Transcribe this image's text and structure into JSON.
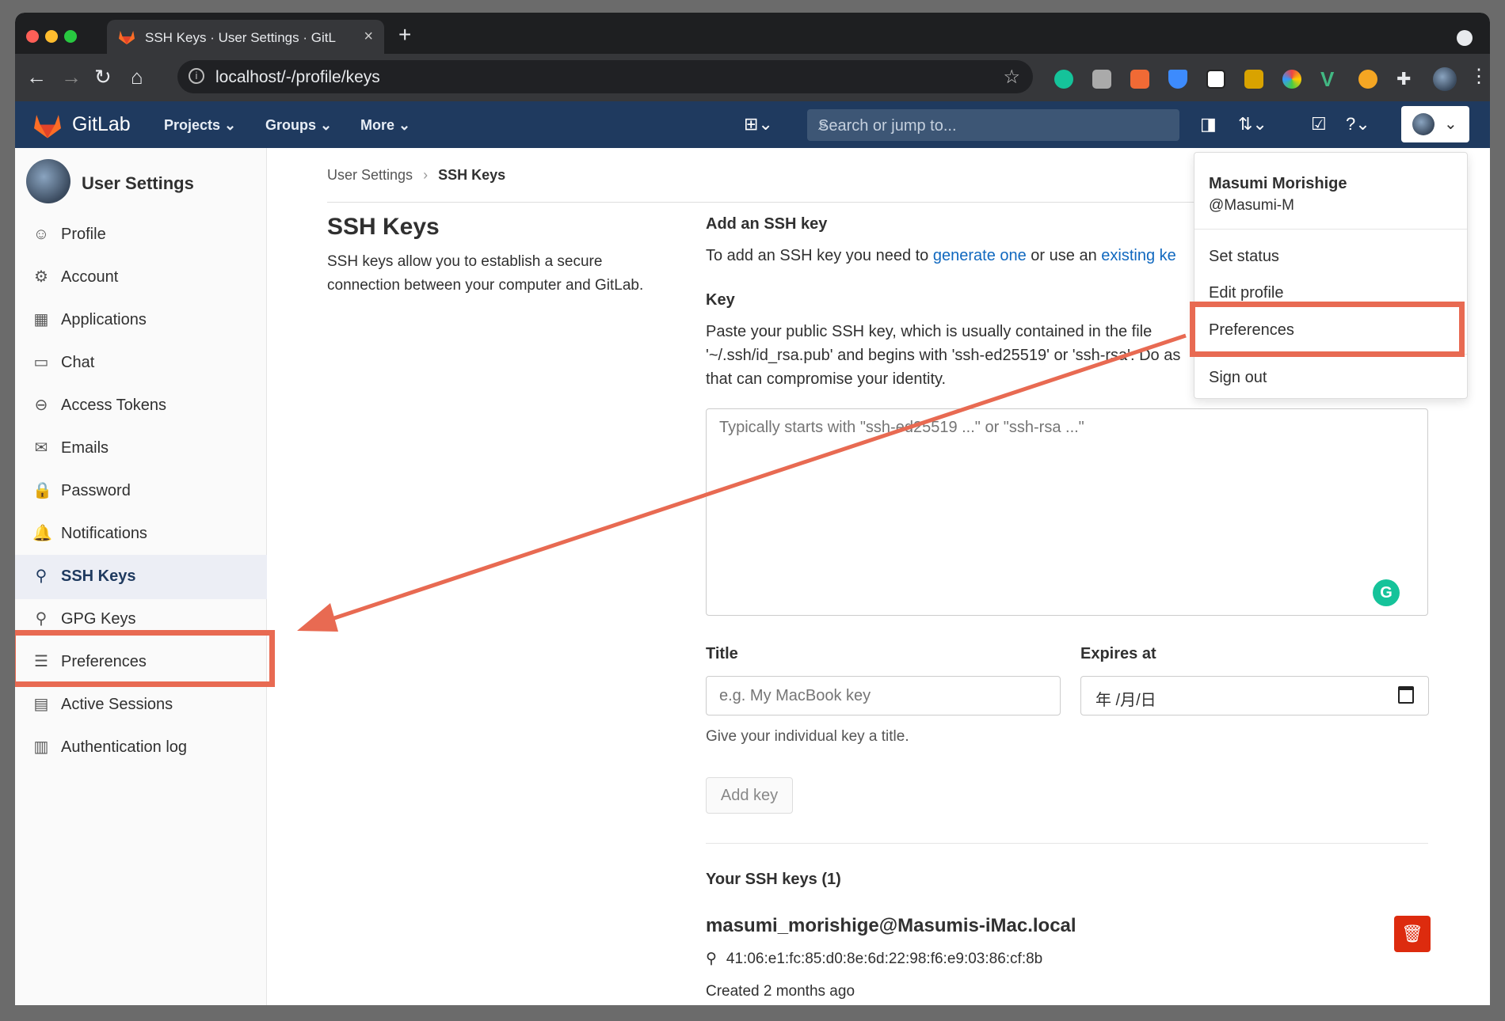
{
  "browser": {
    "tab_title": "SSH Keys · User Settings · GitL",
    "url": "localhost/-/profile/keys",
    "new_tab": "+",
    "close_tab": "×"
  },
  "gitlab_nav": {
    "brand": "GitLab",
    "menus": [
      "Projects",
      "Groups",
      "More"
    ],
    "search_placeholder": "Search or jump to..."
  },
  "sidebar": {
    "title": "User Settings",
    "items": [
      {
        "label": "Profile",
        "icon": "profile-icon"
      },
      {
        "label": "Account",
        "icon": "account-icon"
      },
      {
        "label": "Applications",
        "icon": "applications-icon"
      },
      {
        "label": "Chat",
        "icon": "chat-icon"
      },
      {
        "label": "Access Tokens",
        "icon": "token-icon"
      },
      {
        "label": "Emails",
        "icon": "email-icon"
      },
      {
        "label": "Password",
        "icon": "lock-icon"
      },
      {
        "label": "Notifications",
        "icon": "bell-icon"
      },
      {
        "label": "SSH Keys",
        "icon": "key-icon",
        "active": true
      },
      {
        "label": "GPG Keys",
        "icon": "key-icon"
      },
      {
        "label": "Preferences",
        "icon": "preferences-icon"
      },
      {
        "label": "Active Sessions",
        "icon": "monitor-icon"
      },
      {
        "label": "Authentication log",
        "icon": "log-icon"
      }
    ]
  },
  "breadcrumb": {
    "parent": "User Settings",
    "separator": "›",
    "current": "SSH Keys"
  },
  "main": {
    "heading": "SSH Keys",
    "description": "SSH keys allow you to establish a secure connection between your computer and GitLab.",
    "add_heading": "Add an SSH key",
    "intro_prefix": "To add an SSH key you need to ",
    "intro_link1": "generate one",
    "intro_mid": " or use an ",
    "intro_link2": "existing ke",
    "key_label": "Key",
    "key_help": "Paste your public SSH key, which is usually contained in the file '~/.ssh/id_rsa.pub' and begins with 'ssh-ed25519' or 'ssh-rsa'. Do as that can compromise your identity.",
    "key_placeholder": "Typically starts with \"ssh-ed25519 ...\" or \"ssh-rsa ...\"",
    "title_label": "Title",
    "title_placeholder": "e.g. My MacBook key",
    "expires_label": "Expires at",
    "expires_value": "年 /月/日",
    "title_hint": "Give your individual key a title.",
    "add_button": "Add key",
    "your_keys_heading": "Your SSH keys (1)",
    "key_name": "masumi_morishige@Masumis-iMac.local",
    "fingerprint": "41:06:e1:fc:85:d0:8e:6d:22:98:f6:e9:03:86:cf:8b",
    "created": "Created 2 months ago"
  },
  "user_dropdown": {
    "name": "Masumi Morishige",
    "username": "@Masumi-M",
    "items": [
      "Set status",
      "Edit profile",
      "Preferences",
      "Sign out"
    ]
  },
  "colors": {
    "header": "#1f3a5f",
    "annotation": "#e86a52",
    "link": "#1068bf",
    "danger": "#dd2b0e"
  }
}
